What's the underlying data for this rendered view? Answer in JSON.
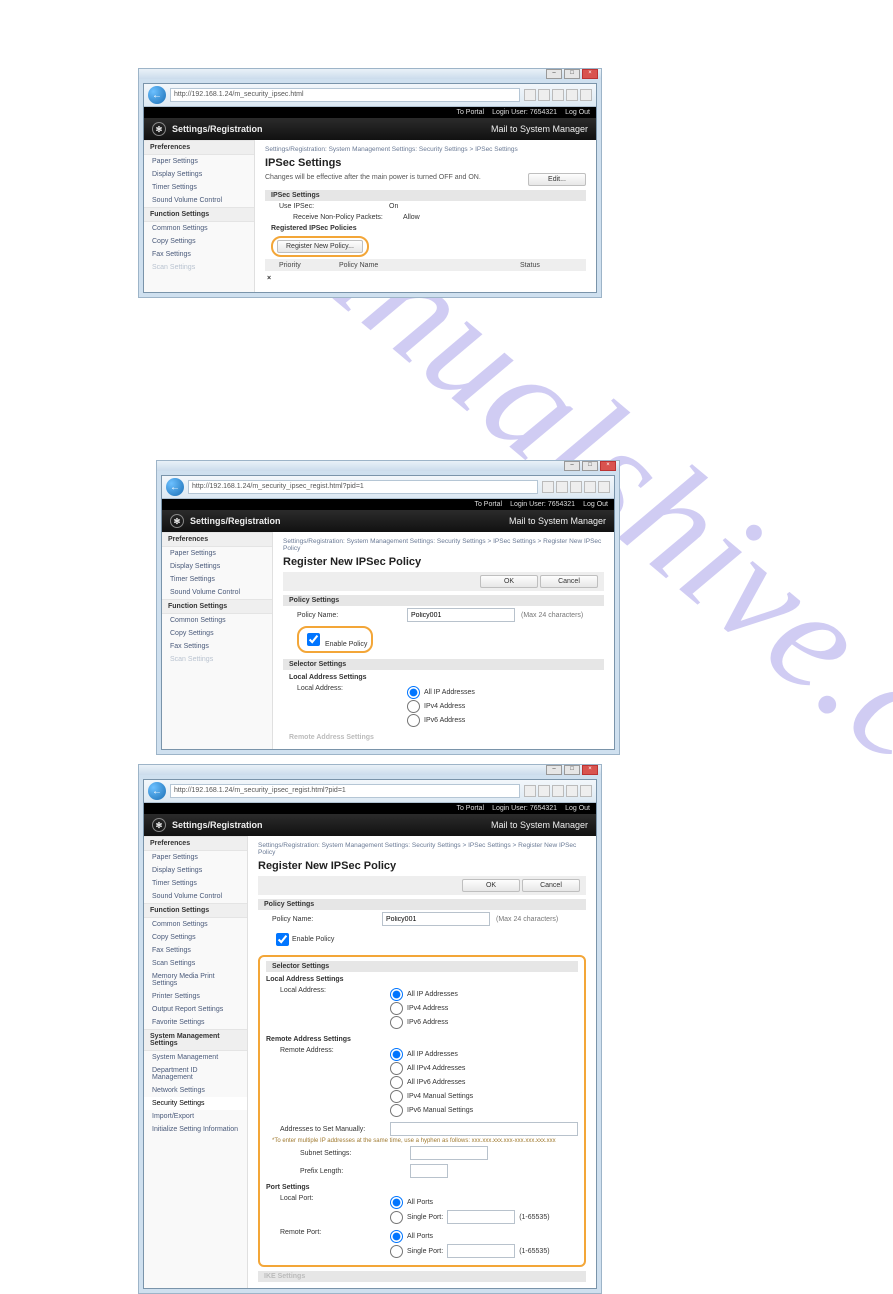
{
  "watermark": "manualshive.com",
  "addressbar": {
    "url1": "http://192.168.1.24/m_security_ipsec.html",
    "url2": "http://192.168.1.24/m_security_ipsec_regist.html?pid=1",
    "url3": "http://192.168.1.24/m_security_ipsec_regist.html?pid=1"
  },
  "topbar": {
    "portal": "To Portal",
    "login_label": "Login User:",
    "user": "7654321",
    "logout": "Log Out",
    "mail": "Mail to System Manager"
  },
  "header": {
    "title": "Settings/Registration"
  },
  "sidebar": {
    "preferences": "Preferences",
    "items_pref": [
      "Paper Settings",
      "Display Settings",
      "Timer Settings",
      "Sound Volume Control"
    ],
    "function": "Function Settings",
    "items_func_short": [
      "Common Settings",
      "Copy Settings",
      "Fax Settings",
      "Scan Settings"
    ],
    "items_func_long": [
      "Common Settings",
      "Copy Settings",
      "Fax Settings",
      "Scan Settings",
      "Memory Media Print Settings",
      "Printer Settings",
      "Output Report Settings",
      "Favorite Settings"
    ],
    "sysmgmt": "System Management Settings",
    "items_sys": [
      "System Management",
      "Department ID Management",
      "Network Settings",
      "Security Settings",
      "Import/Export",
      "Initialize Setting Information"
    ]
  },
  "shot1": {
    "crumbs": "Settings/Registration: System Management Settings: Security Settings > IPSec Settings",
    "title": "IPSec Settings",
    "note": "Changes will be effective after the main power is turned OFF and ON.",
    "edit": "Edit...",
    "sect": "IPSec Settings",
    "use_label": "Use IPSec:",
    "use_value": "On",
    "recv_label": "Receive Non-Policy Packets:",
    "recv_value": "Allow",
    "reg_hdr": "Registered IPSec Policies",
    "reg_btn": "Register New Policy...",
    "col_priority": "Priority",
    "col_name": "Policy Name",
    "col_status": "Status",
    "empty": "×"
  },
  "shot2": {
    "crumbs": "Settings/Registration: System Management Settings: Security Settings > IPSec Settings > Register New IPSec Policy",
    "title": "Register New IPSec Policy",
    "ok": "OK",
    "cancel": "Cancel",
    "sect_policy": "Policy Settings",
    "policy_name_label": "Policy Name:",
    "policy_name_value": "Policy001",
    "policy_hint": "(Max 24 characters)",
    "enable": "Enable Policy",
    "sect_sel": "Selector Settings",
    "local_hdr": "Local Address Settings",
    "local_label": "Local Address:",
    "opt_all": "All IP Addresses",
    "opt_v4": "IPv4 Address",
    "opt_v6": "IPv6 Address",
    "remote_hdr": "Remote Address Settings"
  },
  "shot3": {
    "crumbs": "Settings/Registration: System Management Settings: Security Settings > IPSec Settings > Register New IPSec Policy",
    "title": "Register New IPSec Policy",
    "ok": "OK",
    "cancel": "Cancel",
    "sect_policy": "Policy Settings",
    "policy_name_label": "Policy Name:",
    "policy_name_value": "Policy001",
    "policy_hint": "(Max 24 characters)",
    "enable": "Enable Policy",
    "sect_sel": "Selector Settings",
    "local_hdr": "Local Address Settings",
    "local_label": "Local Address:",
    "opts_local": [
      "All IP Addresses",
      "IPv4 Address",
      "IPv6 Address"
    ],
    "remote_hdr": "Remote Address Settings",
    "remote_label": "Remote Address:",
    "opts_remote": [
      "All IP Addresses",
      "All IPv4 Addresses",
      "All IPv6 Addresses",
      "IPv4 Manual Settings",
      "IPv6 Manual Settings"
    ],
    "addr_manual": "Addresses to Set Manually:",
    "addr_note": "*To enter multiple IP addresses at the same time, use a hyphen as follows: xxx.xxx.xxx.xxx-xxx.xxx.xxx.xxx",
    "subnet": "Subnet Settings:",
    "prefix": "Prefix Length:",
    "port_hdr": "Port Settings",
    "local_port": "Local Port:",
    "remote_port": "Remote Port:",
    "port_all": "All Ports",
    "port_single": "Single Port:",
    "port_range": "(1-65535)",
    "ike": "IKE Settings"
  }
}
